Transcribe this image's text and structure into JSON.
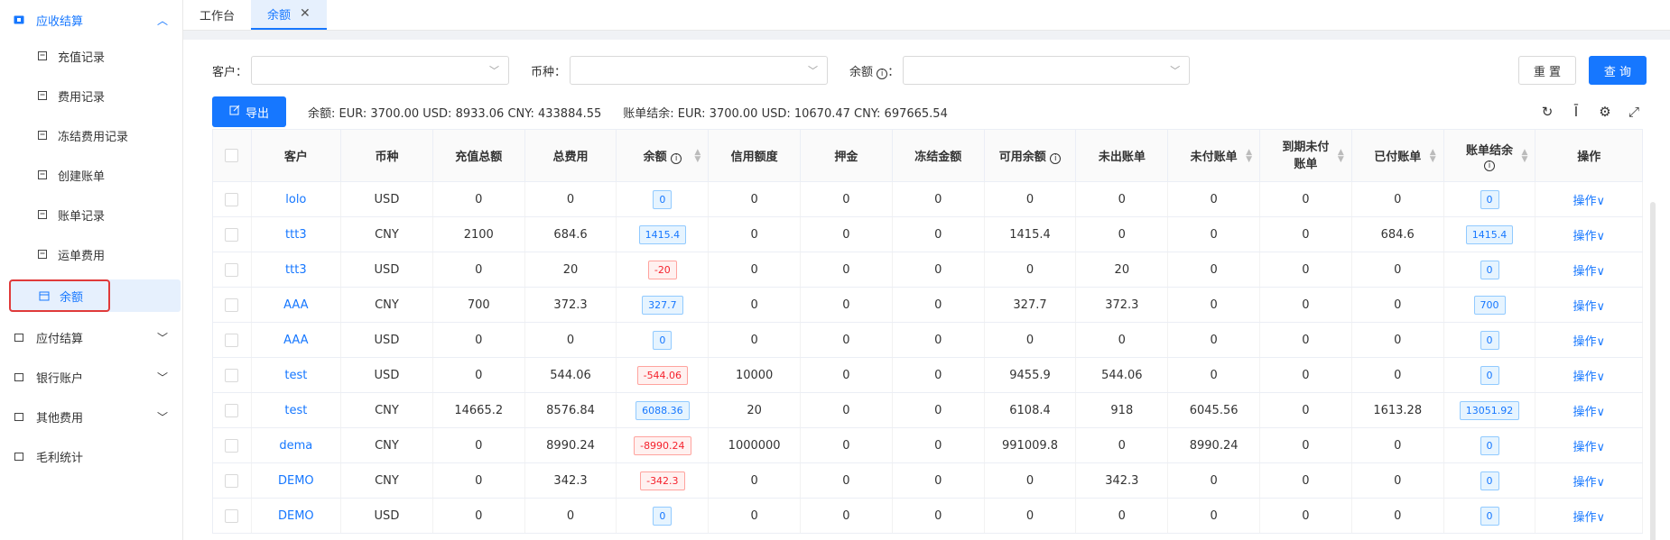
{
  "sidebar": {
    "group_open": {
      "label": "应收结算",
      "icon": "ticket-icon"
    },
    "sub_items": [
      {
        "label": "充值记录",
        "icon": "recharge-icon"
      },
      {
        "label": "费用记录",
        "icon": "fee-icon"
      },
      {
        "label": "冻结费用记录",
        "icon": "freeze-icon"
      },
      {
        "label": "创建账单",
        "icon": "create-bill-icon"
      },
      {
        "label": "账单记录",
        "icon": "bill-record-icon"
      },
      {
        "label": "运单费用",
        "icon": "waybill-icon"
      }
    ],
    "active_item": {
      "label": "余额",
      "icon": "calendar-icon"
    },
    "groups_collapsed": [
      {
        "label": "应付结算",
        "icon": "payable-icon"
      },
      {
        "label": "银行账户",
        "icon": "bank-card-icon"
      },
      {
        "label": "其他费用",
        "icon": "other-fee-icon"
      },
      {
        "label": "毛利统计",
        "icon": "profit-icon"
      }
    ]
  },
  "tabs": [
    {
      "label": "工作台"
    },
    {
      "label": "余额",
      "active": true
    }
  ],
  "filters": {
    "customer_label": "客户：",
    "currency_label": "币种：",
    "balance_label": "余额",
    "reset": "重 置",
    "query": "查 询"
  },
  "toolbar": {
    "export": "导出",
    "balance_summary": "余额: EUR: 3700.00 USD: 8933.06 CNY: 433884.55",
    "bill_summary": "账单结余: EUR: 3700.00 USD: 10670.47 CNY: 697665.54"
  },
  "table": {
    "headers": [
      "客户",
      "币种",
      "充值总额",
      "总费用",
      "余额",
      "信用额度",
      "押金",
      "冻结金额",
      "可用余额",
      "未出账单",
      "未付账单",
      "到期未付账单",
      "已付账单",
      "账单结余",
      "操作"
    ],
    "rows": [
      {
        "customer": "lolo",
        "currency": "USD",
        "recharge": "0",
        "total_fee": "0",
        "balance": "0",
        "balance_type": "blue",
        "credit": "0",
        "deposit": "0",
        "frozen": "0",
        "available": "0",
        "unissued": "0",
        "unpaid": "0",
        "overdue": "0",
        "paid": "0",
        "bill_balance": "0",
        "op": "操作"
      },
      {
        "customer": "ttt3",
        "currency": "CNY",
        "recharge": "2100",
        "total_fee": "684.6",
        "balance": "1415.4",
        "balance_type": "blue",
        "credit": "0",
        "deposit": "0",
        "frozen": "0",
        "available": "1415.4",
        "unissued": "0",
        "unpaid": "0",
        "overdue": "0",
        "paid": "684.6",
        "bill_balance": "1415.4",
        "op": "操作"
      },
      {
        "customer": "ttt3",
        "currency": "USD",
        "recharge": "0",
        "total_fee": "20",
        "balance": "-20",
        "balance_type": "red",
        "credit": "0",
        "deposit": "0",
        "frozen": "0",
        "available": "0",
        "unissued": "20",
        "unpaid": "0",
        "overdue": "0",
        "paid": "0",
        "bill_balance": "0",
        "op": "操作"
      },
      {
        "customer": "AAA",
        "currency": "CNY",
        "recharge": "700",
        "total_fee": "372.3",
        "balance": "327.7",
        "balance_type": "blue",
        "credit": "0",
        "deposit": "0",
        "frozen": "0",
        "available": "327.7",
        "unissued": "372.3",
        "unpaid": "0",
        "overdue": "0",
        "paid": "0",
        "bill_balance": "700",
        "op": "操作"
      },
      {
        "customer": "AAA",
        "currency": "USD",
        "recharge": "0",
        "total_fee": "0",
        "balance": "0",
        "balance_type": "blue",
        "credit": "0",
        "deposit": "0",
        "frozen": "0",
        "available": "0",
        "unissued": "0",
        "unpaid": "0",
        "overdue": "0",
        "paid": "0",
        "bill_balance": "0",
        "op": "操作"
      },
      {
        "customer": "test",
        "currency": "USD",
        "recharge": "0",
        "total_fee": "544.06",
        "balance": "-544.06",
        "balance_type": "red",
        "credit": "10000",
        "deposit": "0",
        "frozen": "0",
        "available": "9455.9",
        "unissued": "544.06",
        "unpaid": "0",
        "overdue": "0",
        "paid": "0",
        "bill_balance": "0",
        "op": "操作"
      },
      {
        "customer": "test",
        "currency": "CNY",
        "recharge": "14665.2",
        "total_fee": "8576.84",
        "balance": "6088.36",
        "balance_type": "blue",
        "credit": "20",
        "deposit": "0",
        "frozen": "0",
        "available": "6108.4",
        "unissued": "918",
        "unpaid": "6045.56",
        "overdue": "0",
        "paid": "1613.28",
        "bill_balance": "13051.92",
        "op": "操作"
      },
      {
        "customer": "dema",
        "currency": "CNY",
        "recharge": "0",
        "total_fee": "8990.24",
        "balance": "-8990.24",
        "balance_type": "red",
        "credit": "1000000",
        "deposit": "0",
        "frozen": "0",
        "available": "991009.8",
        "unissued": "0",
        "unpaid": "8990.24",
        "overdue": "0",
        "paid": "0",
        "bill_balance": "0",
        "op": "操作"
      },
      {
        "customer": "DEMO",
        "currency": "CNY",
        "recharge": "0",
        "total_fee": "342.3",
        "balance": "-342.3",
        "balance_type": "red",
        "credit": "0",
        "deposit": "0",
        "frozen": "0",
        "available": "0",
        "unissued": "342.3",
        "unpaid": "0",
        "overdue": "0",
        "paid": "0",
        "bill_balance": "0",
        "op": "操作"
      },
      {
        "customer": "DEMO",
        "currency": "USD",
        "recharge": "0",
        "total_fee": "0",
        "balance": "0",
        "balance_type": "blue",
        "credit": "0",
        "deposit": "0",
        "frozen": "0",
        "available": "0",
        "unissued": "0",
        "unpaid": "0",
        "overdue": "0",
        "paid": "0",
        "bill_balance": "0",
        "op": "操作"
      }
    ]
  },
  "colors": {
    "primary": "#1677ff",
    "danger": "#f5222d",
    "highlight_box": "#e03a3a"
  }
}
